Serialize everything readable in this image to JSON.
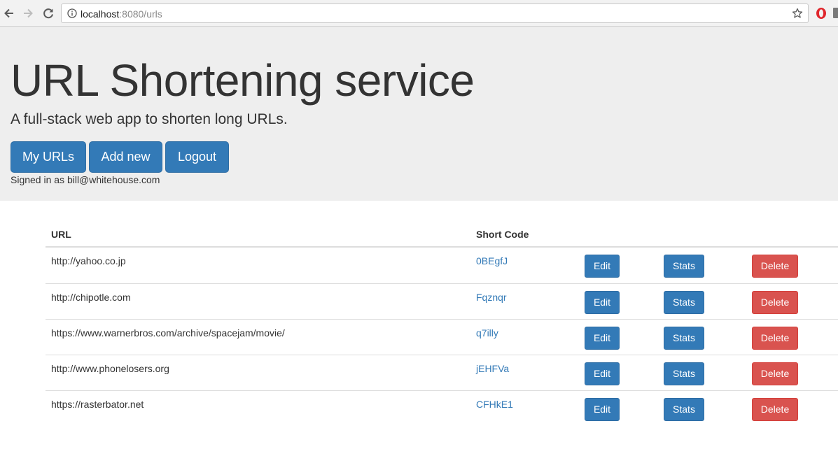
{
  "browser": {
    "url_host": "localhost",
    "url_path": ":8080/urls"
  },
  "header": {
    "title": "URL Shortening service",
    "lead": "A full-stack web app to shorten long URLs.",
    "nav": {
      "my_urls": "My URLs",
      "add_new": "Add new",
      "logout": "Logout"
    },
    "signed_in": "Signed in as bill@whitehouse.com"
  },
  "table": {
    "headers": {
      "url": "URL",
      "short_code": "Short Code"
    },
    "actions": {
      "edit": "Edit",
      "stats": "Stats",
      "delete": "Delete"
    },
    "rows": [
      {
        "url": "http://yahoo.co.jp",
        "code": "0BEgfJ"
      },
      {
        "url": "http://chipotle.com",
        "code": "Fqznqr"
      },
      {
        "url": "https://www.warnerbros.com/archive/spacejam/movie/",
        "code": "q7illy"
      },
      {
        "url": "http://www.phonelosers.org",
        "code": "jEHFVa"
      },
      {
        "url": "https://rasterbator.net",
        "code": "CFHkE1"
      }
    ]
  },
  "colors": {
    "primary": "#337ab7",
    "danger": "#d9534f",
    "jumbotron_bg": "#eeeeee"
  }
}
